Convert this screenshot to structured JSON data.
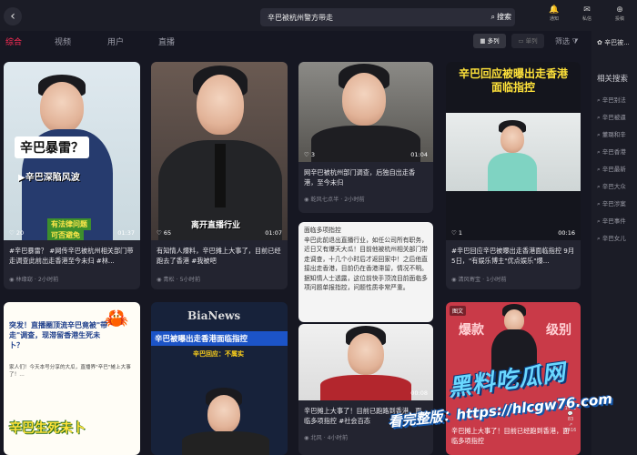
{
  "search": {
    "query": "辛巴被杭州警方带走",
    "button": "搜索"
  },
  "top_right": [
    {
      "icon": "bell-icon",
      "label": "通知",
      "glyph": "🔔"
    },
    {
      "icon": "chat-icon",
      "label": "私信",
      "glyph": "✉"
    },
    {
      "icon": "upload-icon",
      "label": "投稿",
      "glyph": "⊕"
    }
  ],
  "tabs": [
    "综合",
    "视频",
    "用户",
    "直播"
  ],
  "view": {
    "grid": "多列",
    "single": "单列",
    "filter": "筛选"
  },
  "cards": [
    {
      "overlay": "辛巴暴雷？",
      "sub": "▶辛巴深陷风波",
      "tag1": "有法律问题",
      "tag2": "可否避免",
      "likes": "20",
      "duration": "01:37",
      "title": "#辛巴暴雷？ #网传辛巴被杭州相关部门带走调查此前出走香港至今未归 #林...",
      "author": "林缘窈",
      "time": "2小时前"
    },
    {
      "overlay": "",
      "sub": "",
      "tag1": "",
      "tag2": "",
      "caption": "离开直播行业",
      "likes": "65",
      "duration": "01:07",
      "title": "有知情人爆料，辛巴摊上大事了，目前已经跑去了香港 #我被吧",
      "author": "青松",
      "time": "5小时前"
    },
    {
      "overlay": "",
      "sub": "",
      "tag1": "",
      "tag2": "",
      "likes": "3",
      "duration": "01:04",
      "title": "网辛巴被杭州部门调查，后独自出走香港，至今未归",
      "author": "乾风七点半",
      "time": "2小时前"
    },
    {
      "overlay": "辛巴回应被曝出走香港面临指控",
      "sub": "",
      "tag1": "",
      "tag2": "",
      "likes": "1",
      "duration": "00:16",
      "title": "#辛巴回应辛巴被曝出走香港面临指控 9月5日，\"有娱乐博主\"优点娱乐\"爆...",
      "author": "清风寄宝",
      "time": "1小时前"
    },
    {
      "overlay": "",
      "sub": "",
      "tag1": "",
      "tag2": "",
      "text_body": "面临多项指控\n辛巴此前退出直播行业，如任公司所有职务，近日又有爆天大瓜！目前他被杭州相关部门带走调查，十几个小时后才返回家中！之后他直接出走香港，目前仍在香港滞留，情况不明。据知情人士透露，这位前快手顶流目前面临多项问题单报指控，问题性质非常严重。",
      "likes": "",
      "duration": "",
      "title": "",
      "author": "",
      "time": ""
    },
    {
      "overlay": "",
      "sub": "",
      "tag1": "",
      "tag2": "",
      "likes": "",
      "duration": "00:08",
      "title": "辛巴摊上大事了！目前已跑路到香港，面临多项指控 #社会百态",
      "author": "北风",
      "time": "4小时前"
    },
    {
      "overlay": "突发！直播圈顶流辛巴竟被\"带走\"调查，现滞留香港生死未卜？",
      "sub": "家人们！今天本号分享的大瓜，直播界\"辛巴\"摊上大事了！…",
      "tag1": "辛巴生死未卜",
      "tag2": "",
      "likes": "",
      "duration": "",
      "title": "",
      "author": "",
      "time": ""
    },
    {
      "overlay": "辛巴被曝出走香港面临指控",
      "sub": "辛巴回应：不属实",
      "tag1": "BiaNews",
      "tag2": "",
      "likes": "",
      "duration": "",
      "title": "",
      "author": "",
      "time": ""
    },
    {
      "overlay": "级别",
      "sub": "爆款",
      "tag1": "图文",
      "tag2": "",
      "likes": "",
      "duration": "",
      "title": "辛巴摊上大事了！目前已经跑到香港，面临多项指控",
      "author": "",
      "time": ""
    }
  ],
  "right_panel": {
    "user": "辛巴被...",
    "heading": "相关搜索",
    "items": [
      "辛巴别法",
      "辛巴被逼",
      "董璐和辛",
      "辛巴香港",
      "辛巴最新",
      "辛巴大众",
      "辛巴涉案",
      "辛巴事件",
      "辛巴女儿"
    ]
  },
  "watermark": {
    "line1": "黑料吃瓜网",
    "line2": "看完整版：https://hlcgw76.com"
  },
  "side_counts": [
    "1711",
    "83",
    "1416"
  ]
}
